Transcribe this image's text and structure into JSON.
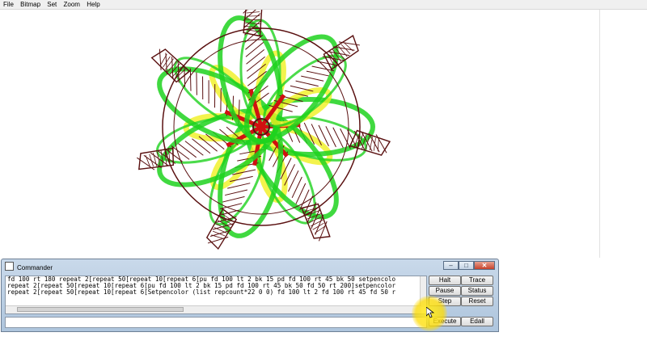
{
  "menu": [
    "File",
    "Bitmap",
    "Set",
    "Zoom",
    "Help"
  ],
  "commander": {
    "title": "Commander",
    "history": [
      "fd 100 rt 180 repeat 2[repeat 50[repeat 10[repeat 6[pu fd 100 lt 2 bk 15 pd fd 100 rt 45 bk 50 setpencolo",
      "repeat 2[repeat 50[repeat 10[repeat 6[pu fd 100 lt 2 bk 15 pd fd 100 rt 45 bk 50 fd 50 rt 200]setpencolor",
      "repeat 2[repeat 50[repeat 10[repeat 6[Setpencolor (list repcount*22 0 0) fd 100 lt 2 fd 100 rt 45 fd 50 r"
    ],
    "input_value": "",
    "buttons": {
      "halt": "Halt",
      "trace": "Trace",
      "pause": "Pause",
      "status": "Status",
      "step": "Step",
      "reset": "Reset",
      "execute": "Execute",
      "edall": "Edall"
    }
  },
  "colors": {
    "green": "#1ed21e",
    "darkred": "#5a1010",
    "red": "#d01010",
    "yellow": "#f0f020"
  }
}
